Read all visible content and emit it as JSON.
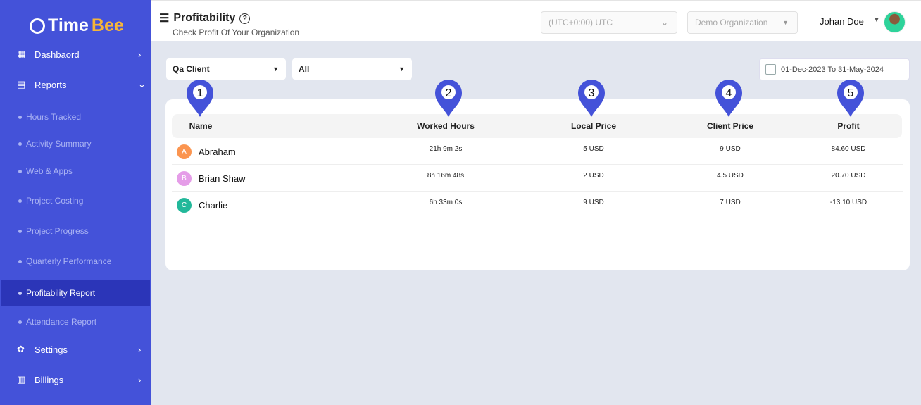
{
  "app": {
    "logo": "TimeBee",
    "logo_a": "Time",
    "logo_b": "Bee"
  },
  "sidebar": {
    "items": [
      {
        "label": "Dashbaord",
        "icon": "dashboard-icon"
      },
      {
        "label": "Reports",
        "icon": "report-icon",
        "expanded": true
      },
      {
        "label": "Settings",
        "icon": "gear-icon"
      },
      {
        "label": "Billings",
        "icon": "billing-icon"
      }
    ],
    "sub_items": [
      {
        "label": "Hours Tracked"
      },
      {
        "label": "Activity Summary"
      },
      {
        "label": "Web & Apps"
      },
      {
        "label": "Project Costing"
      },
      {
        "label": "Project Progress"
      },
      {
        "label": "Quarterly Performance"
      },
      {
        "label": "Profitability Report",
        "active": true
      },
      {
        "label": "Attendance Report"
      }
    ]
  },
  "header": {
    "title": "Profitability",
    "subtitle": "Check Profit Of Your Organization",
    "timezone": "(UTC+0:00) UTC",
    "organization": "Demo Organization",
    "user": "Johan Doe"
  },
  "filters": {
    "client": "Qa Client",
    "project": "All",
    "date_range": "01-Dec-2023 To 31-May-2024"
  },
  "table": {
    "columns": [
      "Name",
      "Worked Hours",
      "Local Price",
      "Client Price",
      "Profit"
    ],
    "markers": [
      "1",
      "2",
      "3",
      "4",
      "5"
    ],
    "rows": [
      {
        "initial": "A",
        "color": "#fb9550",
        "name": "Abraham",
        "hours": "21h 9m 2s",
        "local": "5 USD",
        "client": "9 USD",
        "profit": "84.60 USD"
      },
      {
        "initial": "B",
        "color": "#e59de8",
        "name": "Brian Shaw",
        "hours": "8h 16m 48s",
        "local": "2 USD",
        "client": "4.5 USD",
        "profit": "20.70 USD"
      },
      {
        "initial": "C",
        "color": "#22b89a",
        "name": "Charlie",
        "hours": "6h 33m 0s",
        "local": "9 USD",
        "client": "7 USD",
        "profit": "-13.10 USD"
      }
    ]
  },
  "colors": {
    "sidebar": "#4452d9",
    "active": "#2b35b8",
    "marker": "#4452d9"
  }
}
